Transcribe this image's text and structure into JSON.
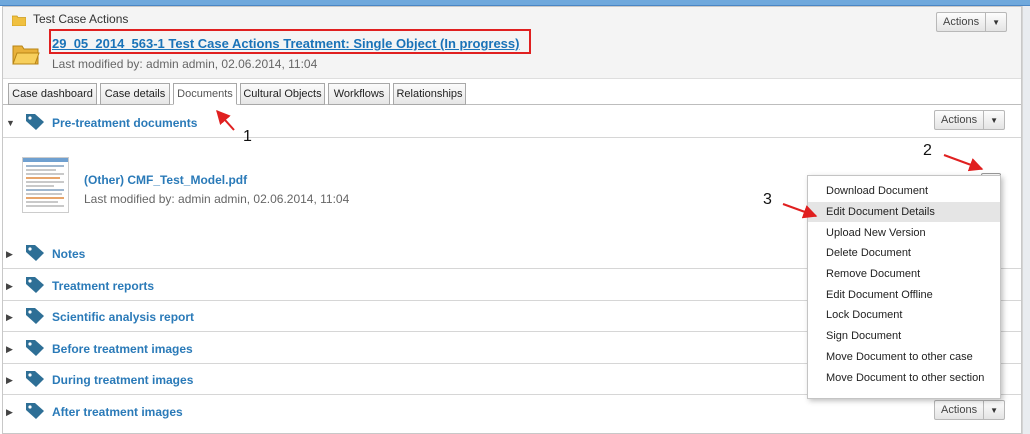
{
  "header": {
    "breadcrumb": "Test Case Actions",
    "title": "29_05_2014_563-1 Test Case Actions Treatment: Single Object (In progress)",
    "modified": "Last modified by: admin admin, 02.06.2014, 11:04",
    "actions_label": "Actions"
  },
  "tabs": [
    "Case dashboard",
    "Case details",
    "Documents",
    "Cultural Objects",
    "Workflows",
    "Relationships"
  ],
  "active_tab": "Documents",
  "sections": {
    "pre_treatment": {
      "name": "Pre-treatment documents",
      "actions_label": "Actions"
    },
    "notes": "Notes",
    "treatment_reports": "Treatment reports",
    "scientific": "Scientific analysis report",
    "before_images": "Before treatment images",
    "during_images": "During treatment images",
    "after_images": {
      "name": "After treatment images",
      "actions_label": "Actions"
    }
  },
  "document": {
    "name": "(Other) CMF_Test_Model.pdf",
    "modified": "Last modified by: admin admin, 02.06.2014, 11:04"
  },
  "menu": {
    "items": [
      "Download Document",
      "Edit Document Details",
      "Upload New Version",
      "Delete Document",
      "Remove Document",
      "Edit Document Offline",
      "Lock Document",
      "Sign Document",
      "Move Document to other case",
      "Move Document to other section"
    ],
    "highlighted": "Edit Document Details"
  },
  "callouts": [
    "1",
    "2",
    "3"
  ],
  "colors": {
    "link": "#2a7ab8",
    "annotation": "#e02020",
    "tag_icon": "#2e6f96"
  }
}
